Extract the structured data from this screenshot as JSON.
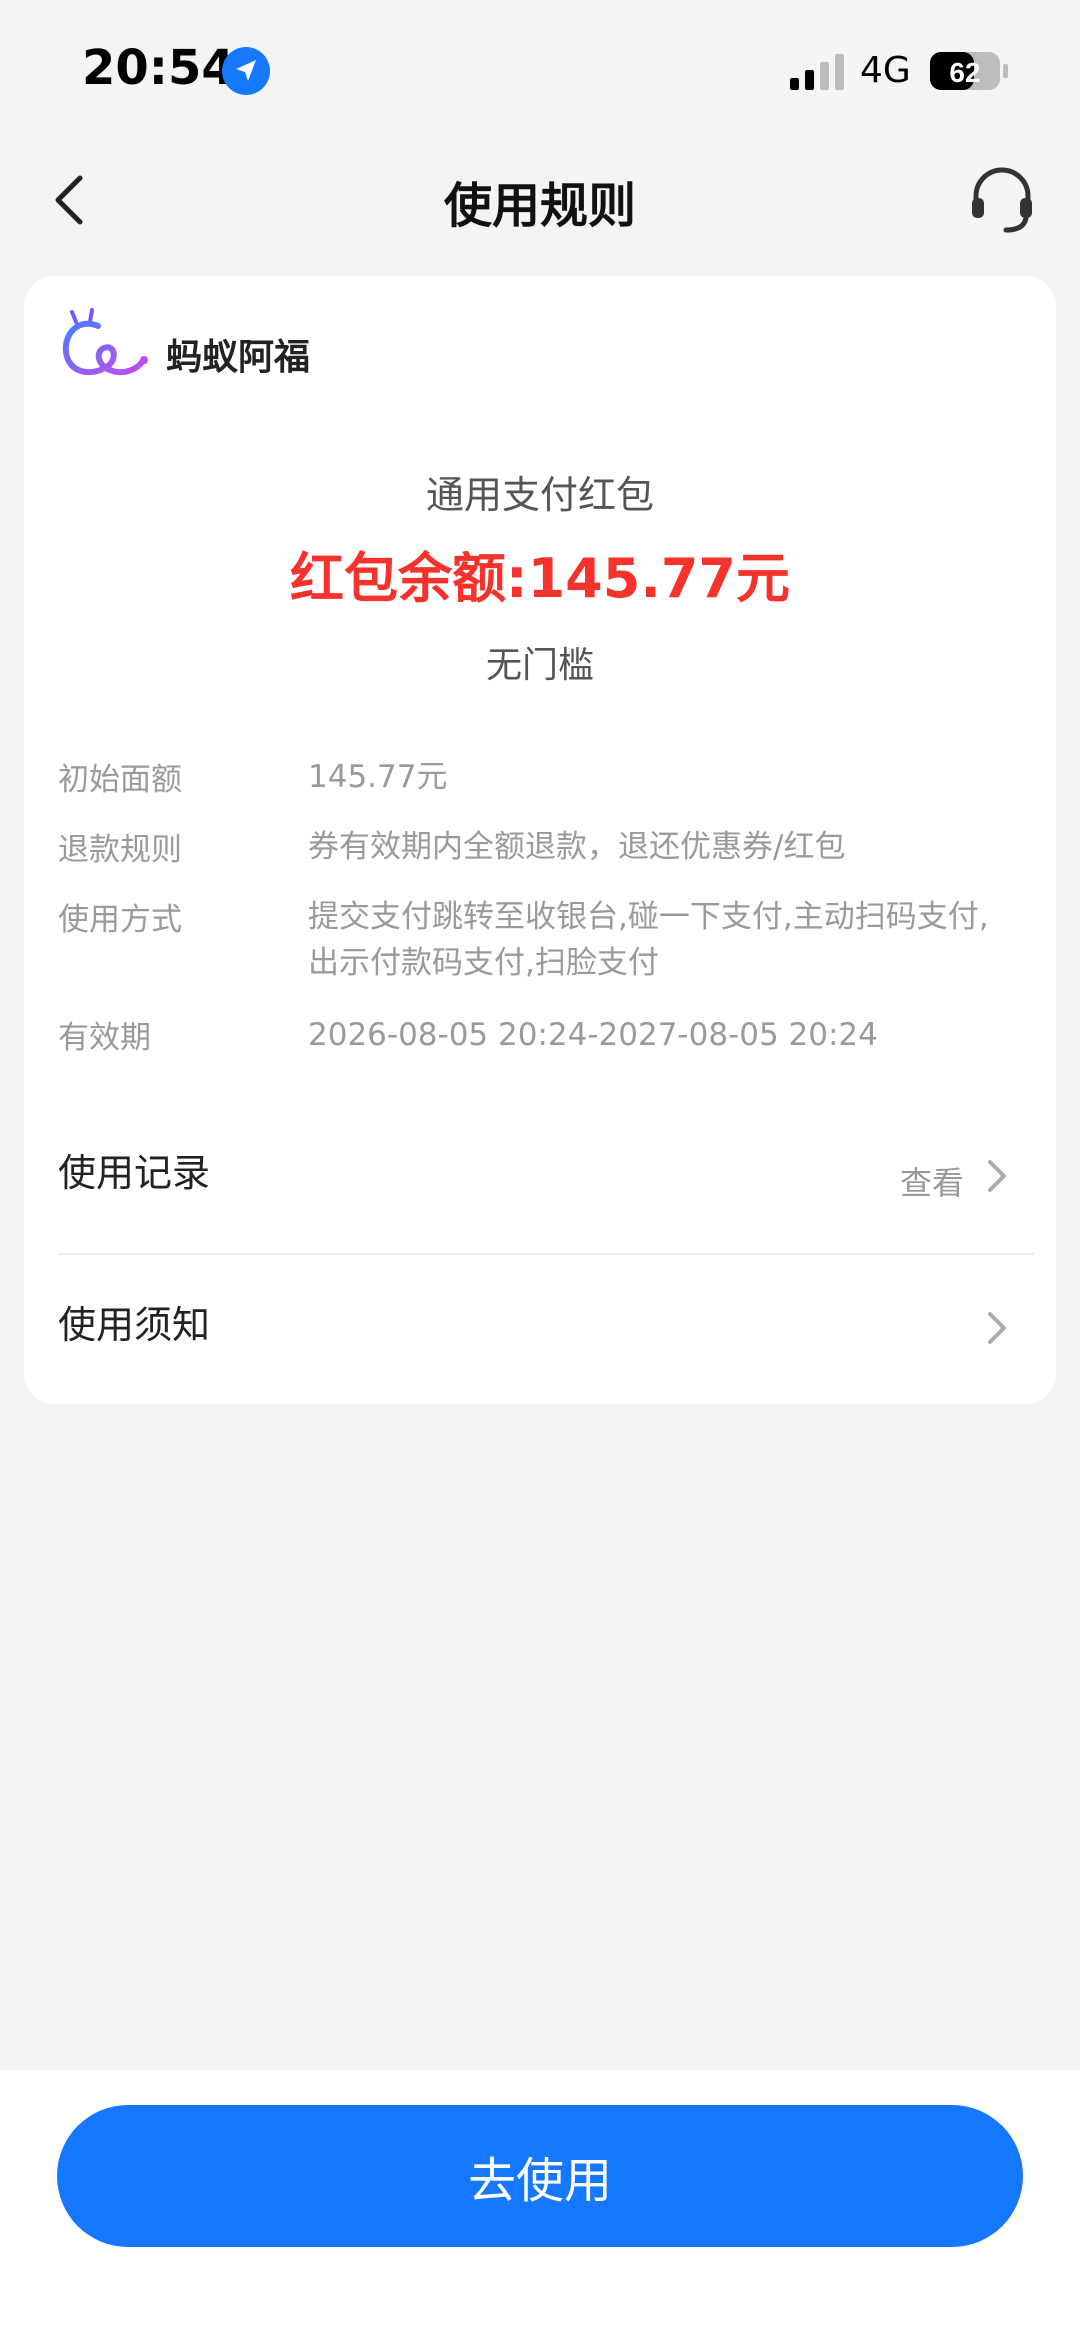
{
  "status_bar": {
    "time": "20:54",
    "network": "4G",
    "battery": "62"
  },
  "nav": {
    "title": "使用规则"
  },
  "brand": {
    "name": "蚂蚁阿福"
  },
  "coupon": {
    "type": "通用支付红包",
    "balance": "红包余额:145.77元",
    "threshold": "无门槛"
  },
  "rules": [
    {
      "label": "初始面额",
      "value": "145.77元"
    },
    {
      "label": "退款规则",
      "value": "券有效期内全额退款，退还优惠券/红包"
    },
    {
      "label": "使用方式",
      "value": "提交支付跳转至收银台,碰一下支付,主动扫码支付,出示付款码支付,扫脸支付"
    },
    {
      "label": "有效期",
      "value": "2026-08-05 20:24-2027-08-05 20:24"
    }
  ],
  "rows": {
    "usage_title": "使用记录",
    "usage_link": "查看",
    "notice_title": "使用须知"
  },
  "action": {
    "label": "去使用"
  },
  "colors": {
    "accent": "#1677ff",
    "balance": "#f5322b"
  }
}
